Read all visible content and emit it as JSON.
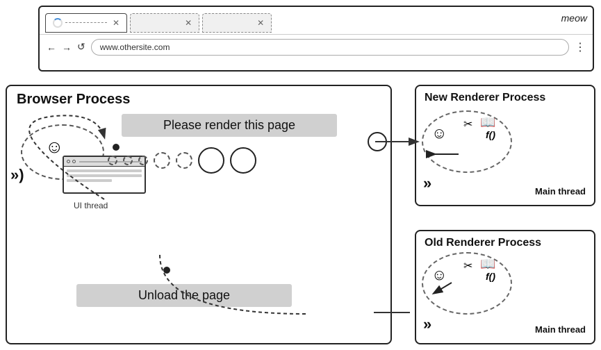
{
  "browser": {
    "tabs": [
      {
        "label": "",
        "loading": true,
        "active": true
      },
      {
        "label": "",
        "loading": false,
        "active": false
      },
      {
        "label": "",
        "loading": false,
        "active": false
      }
    ],
    "meow_label": "meow",
    "url": "www.othersite.com",
    "nav": {
      "back": "←",
      "forward": "→",
      "refresh": "↺"
    }
  },
  "diagram": {
    "browser_process_label": "Browser Process",
    "new_renderer_label": "New Renderer Process",
    "old_renderer_label": "Old Renderer Process",
    "message_render": "Please render this page",
    "message_unload": "Unload the page",
    "ui_thread": "UI thread",
    "main_thread": "Main thread",
    "chevrons_left": "»)",
    "chevrons_new": "»",
    "chevrons_old": "»"
  }
}
